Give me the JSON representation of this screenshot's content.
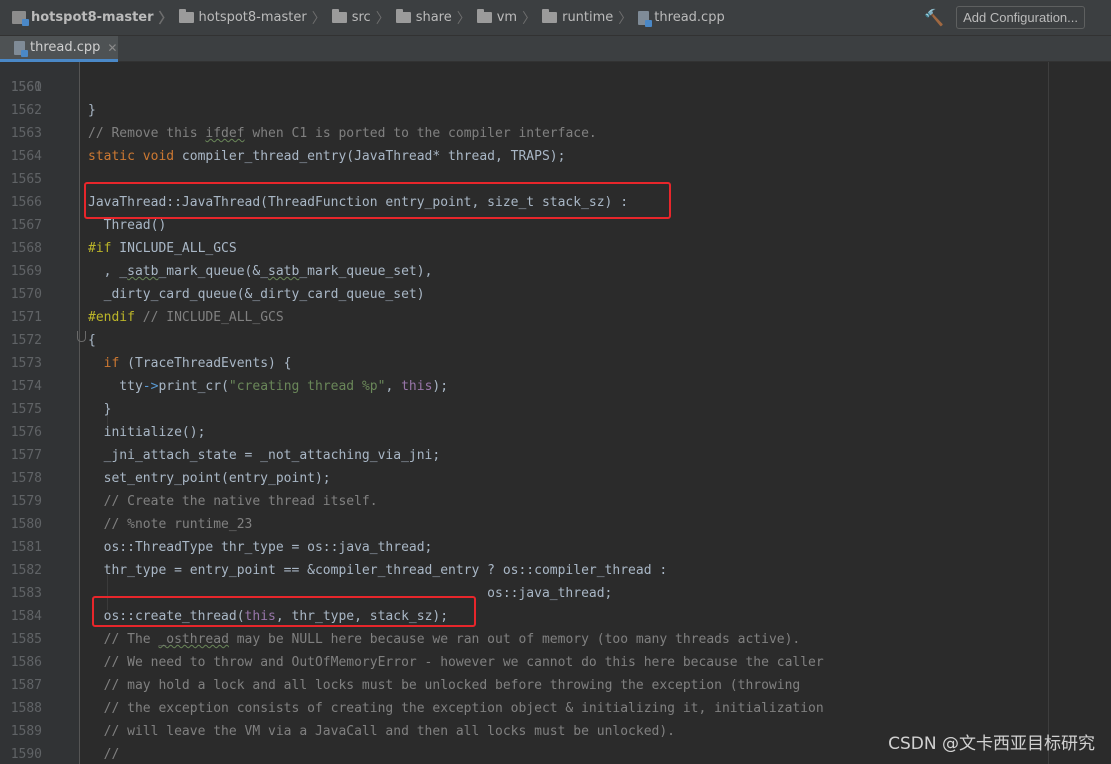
{
  "breadcrumb": [
    {
      "label": "hotspot8-master",
      "icon": "module-icon"
    },
    {
      "label": "hotspot8-master",
      "icon": "folder-icon"
    },
    {
      "label": "src",
      "icon": "folder-icon"
    },
    {
      "label": "share",
      "icon": "folder-icon"
    },
    {
      "label": "vm",
      "icon": "folder-icon"
    },
    {
      "label": "runtime",
      "icon": "folder-icon"
    },
    {
      "label": "thread.cpp",
      "icon": "cpp-file-icon"
    }
  ],
  "toolbar": {
    "add_configuration": "Add Configuration..."
  },
  "tab": {
    "label": "thread.cpp",
    "close": "✕"
  },
  "partial_line": {
    "number": "1560",
    "text": "}"
  },
  "code_lines": [
    {
      "number": "1561",
      "html": ""
    },
    {
      "number": "1562",
      "html": ""
    },
    {
      "number": "1563",
      "html": "<span class=\"cm\">// Remove this <span class=\"typo\">ifdef</span> when C1 is ported to the compiler interface.</span>"
    },
    {
      "number": "1564",
      "html": "<span class=\"kw\">static void </span>compiler_thread_entry(JavaThread* thread, TRAPS);"
    },
    {
      "number": "1565",
      "html": ""
    },
    {
      "number": "1566",
      "html": "JavaThread::JavaThread(ThreadFunction entry_point, size_t stack_sz) :"
    },
    {
      "number": "1567",
      "html": "  Thread()"
    },
    {
      "number": "1568",
      "html": "<span class=\"pp\">#if</span> INCLUDE_ALL_GCS"
    },
    {
      "number": "1569",
      "html": "  , _<span class=\"typo\">satb</span>_mark_queue(&amp;_<span class=\"typo\">satb</span>_mark_queue_set),"
    },
    {
      "number": "1570",
      "html": "  _dirty_card_queue(&amp;_dirty_card_queue_set)"
    },
    {
      "number": "1571",
      "html": "<span class=\"pp\">#endif</span> <span class=\"cm\">// INCLUDE_ALL_GCS</span>"
    },
    {
      "number": "1572",
      "html": "{"
    },
    {
      "number": "1573",
      "html": "  <span class=\"kw\">if</span> (TraceThreadEvents) {"
    },
    {
      "number": "1574",
      "html": "    tty<span class=\"arrow\">-&gt;</span>print_cr(<span class=\"str\">\"creating thread %p\"</span>, <span class=\"ths\">this</span>);"
    },
    {
      "number": "1575",
      "html": "  }"
    },
    {
      "number": "1576",
      "html": "  initialize();"
    },
    {
      "number": "1577",
      "html": "  _jni_attach_state = _not_attaching_via_jni;"
    },
    {
      "number": "1578",
      "html": "  set_entry_point(entry_point);"
    },
    {
      "number": "1579",
      "html": "  <span class=\"cm\">// Create the native thread itself.</span>"
    },
    {
      "number": "1580",
      "html": "  <span class=\"cm\">// %note runtime_23</span>"
    },
    {
      "number": "1581",
      "html": "  os::ThreadType thr_type = os::java_thread;"
    },
    {
      "number": "1582",
      "html": "  thr_type = entry_point == &amp;compiler_thread_entry ? os::compiler_thread :"
    },
    {
      "number": "1583",
      "html": "                                                   os::java_thread;"
    },
    {
      "number": "1584",
      "html": "  os::create_thread(<span class=\"ths\">this</span>, thr_type, stack_sz);"
    },
    {
      "number": "1585",
      "html": "  <span class=\"cm\">// The <span class=\"typo\">_osthread</span> may be NULL here because we ran out of memory (too many threads active).</span>"
    },
    {
      "number": "1586",
      "html": "  <span class=\"cm\">// We need to throw and OutOfMemoryError - however we cannot do this here because the caller</span>"
    },
    {
      "number": "1587",
      "html": "  <span class=\"cm\">// may hold a lock and all locks must be unlocked before throwing the exception (throwing</span>"
    },
    {
      "number": "1588",
      "html": "  <span class=\"cm\">// the exception consists of creating the exception object &amp; initializing it, initialization</span>"
    },
    {
      "number": "1589",
      "html": "  <span class=\"cm\">// will leave the VM via a JavaCall and then all locks must be unlocked).</span>"
    },
    {
      "number": "1590",
      "html": "  <span class=\"cm\">//</span>"
    }
  ],
  "watermark": "CSDN @文卡西亚目标研究",
  "colors": {
    "highlight_box": "#e8262b",
    "accent": "#4a88c7"
  }
}
